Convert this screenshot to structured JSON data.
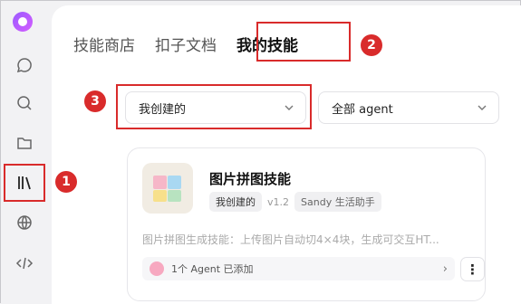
{
  "tabs": [
    {
      "label": "技能商店"
    },
    {
      "label": "扣子文档"
    },
    {
      "label": "我的技能"
    }
  ],
  "filters": {
    "created": "我创建的",
    "agent": "全部 agent"
  },
  "card": {
    "name": "图片拼图技能",
    "tag": "我创建的",
    "version": "v1.2",
    "author": "Sandy 生活助手",
    "description": "图片拼图生成技能：上传图片自动切4×4块，生成可交互HT...",
    "agents": "1个 Agent 已添加",
    "more": "⋮"
  },
  "annotations": {
    "b1": "1",
    "b2": "2",
    "b3": "3"
  },
  "colors": {
    "highlight": "#d92b2b",
    "logo": "#9b5cff"
  }
}
